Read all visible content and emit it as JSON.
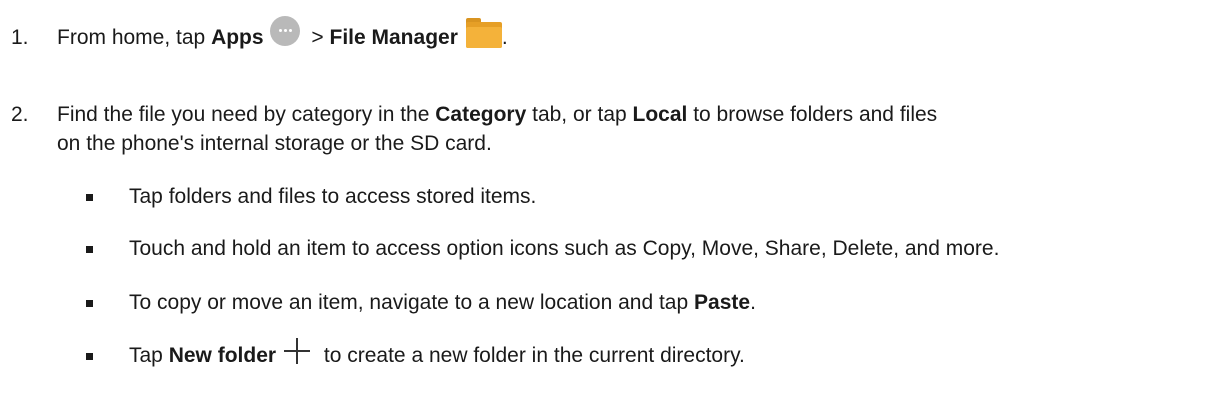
{
  "steps": [
    {
      "number": "1.",
      "text_before": "From home, tap ",
      "bold_1": "Apps",
      "separator": " > ",
      "bold_2": "File Manager",
      "text_end": ".",
      "icons": [
        "apps-icon",
        "file-manager-folder-icon"
      ]
    },
    {
      "number": "2.",
      "line1_before": "Find the file you need by category in the ",
      "line1_bold_1": "Category",
      "line1_mid": " tab, or tap ",
      "line1_bold_2": "Local",
      "line1_after": " to browse folders and files",
      "line2": "on the phone's internal storage or the SD card."
    }
  ],
  "bullets": [
    {
      "text": "Tap folders and files to access stored items."
    },
    {
      "text": "Touch and hold an item to access option icons such as Copy, Move, Share, Delete, and more."
    },
    {
      "text_before": "To copy or move an item, navigate to a new location and tap ",
      "bold": "Paste",
      "text_after": "."
    },
    {
      "text_before": "Tap ",
      "bold": "New folder",
      "text_after": " to create a new folder in the current directory.",
      "icon": "plus-icon"
    }
  ],
  "colors": {
    "text": "#1a1a1a",
    "apps_icon": "#b9b9b9",
    "folder": "#f4b23a"
  }
}
